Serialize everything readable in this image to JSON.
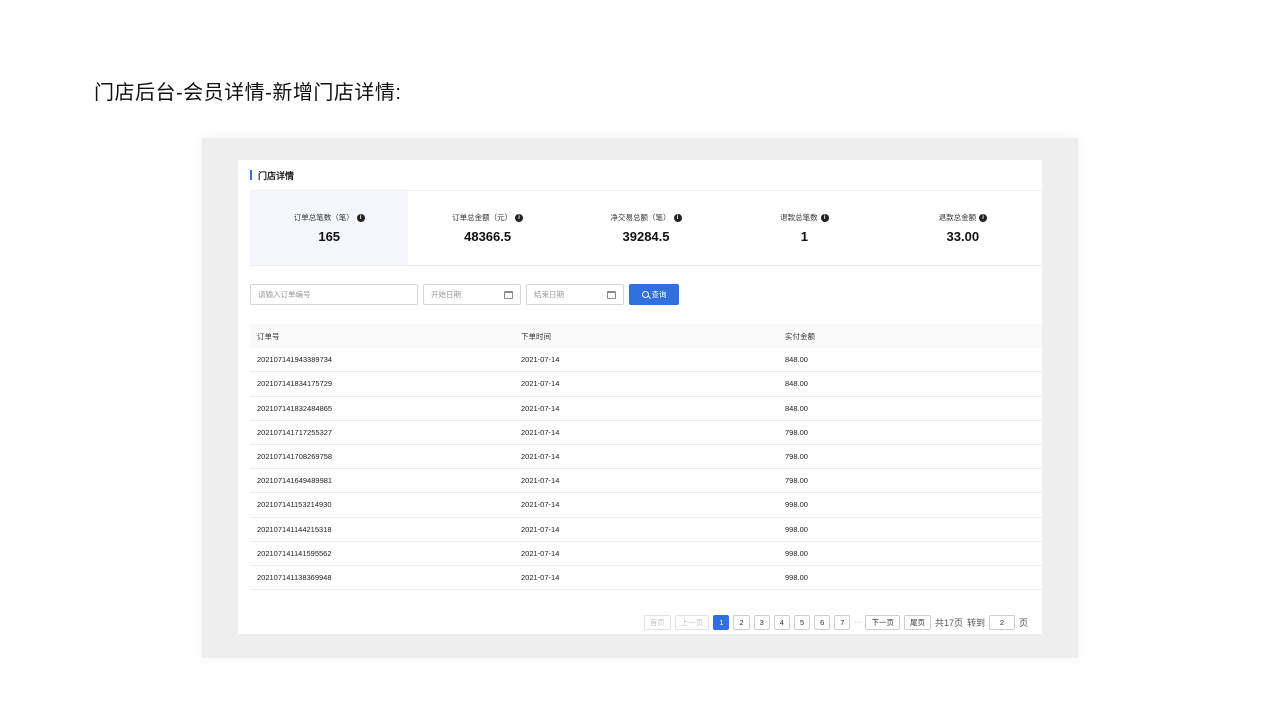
{
  "page_title": "门店后台-会员详情-新增门店详情:",
  "panel": {
    "title": "门店详情"
  },
  "stats": [
    {
      "label": "订单总笔数（笔）",
      "value": "165"
    },
    {
      "label": "订单总金额（元）",
      "value": "48366.5"
    },
    {
      "label": "净交易总额（笔）",
      "value": "39284.5"
    },
    {
      "label": "退款总笔数",
      "value": "1"
    },
    {
      "label": "退款总金额",
      "value": "33.00"
    }
  ],
  "filters": {
    "order_placeholder": "请输入订单编号",
    "start_placeholder": "开始日期",
    "end_placeholder": "结束日期",
    "query_label": "查询"
  },
  "table": {
    "columns": [
      "订单号",
      "下单时间",
      "实付金额"
    ],
    "rows": [
      [
        "202107141943389734",
        "2021-07-14",
        "848.00"
      ],
      [
        "202107141834175729",
        "2021-07-14",
        "848.00"
      ],
      [
        "202107141832484865",
        "2021-07-14",
        "848.00"
      ],
      [
        "202107141717255327",
        "2021-07-14",
        "798.00"
      ],
      [
        "202107141708269758",
        "2021-07-14",
        "798.00"
      ],
      [
        "202107141649489981",
        "2021-07-14",
        "798.00"
      ],
      [
        "202107141153214930",
        "2021-07-14",
        "998.00"
      ],
      [
        "202107141144215318",
        "2021-07-14",
        "998.00"
      ],
      [
        "202107141141595562",
        "2021-07-14",
        "998.00"
      ],
      [
        "202107141138369948",
        "2021-07-14",
        "998.00"
      ]
    ]
  },
  "pagination": {
    "first": "首页",
    "prev": "上一页",
    "pages": [
      "1",
      "2",
      "3",
      "4",
      "5",
      "6",
      "7"
    ],
    "current": "1",
    "ellipsis": "···",
    "next": "下一页",
    "last": "尾页",
    "total_text": "共17页",
    "goto_text": "转到",
    "goto_value": "2",
    "page_unit": "页"
  },
  "colors": {
    "accent": "#2f6fe0",
    "stat_highlight": "#f4f6fc"
  },
  "icons": {
    "info": "info-circle-icon",
    "calendar": "calendar-icon",
    "search": "search-icon"
  }
}
